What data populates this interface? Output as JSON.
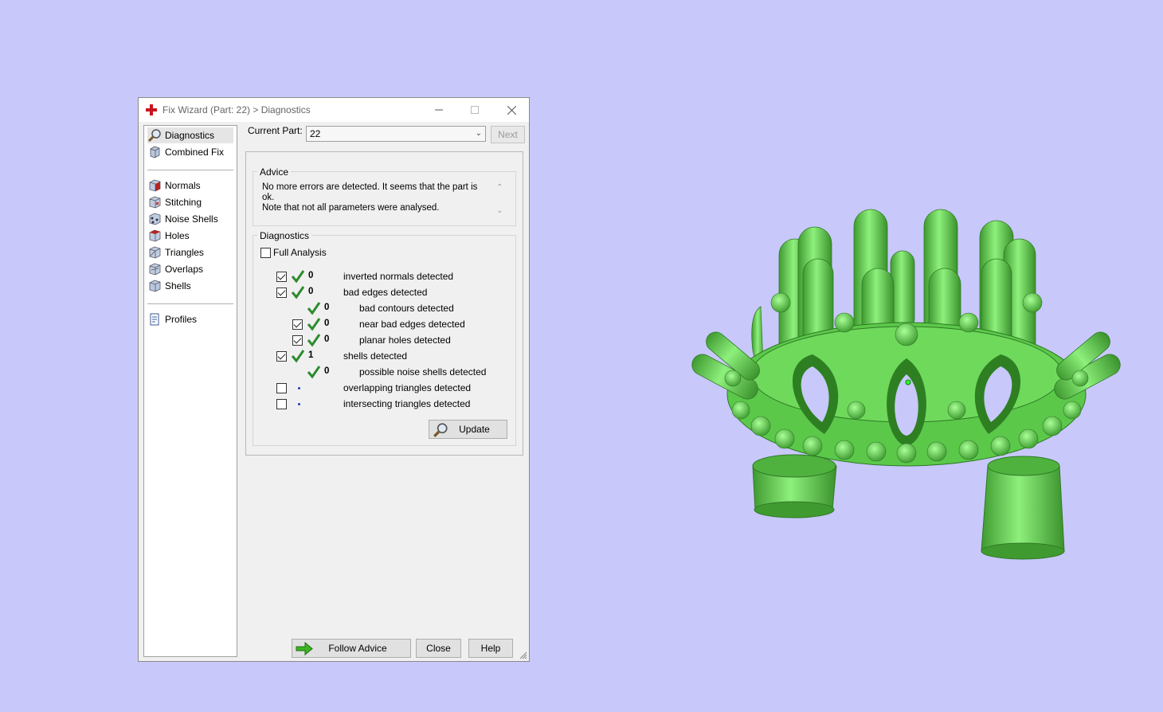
{
  "window": {
    "title": "Fix Wizard (Part: 22) > Diagnostics"
  },
  "sidebar": {
    "items": [
      {
        "label": "Diagnostics",
        "icon": "magnifier-icon",
        "selected": true
      },
      {
        "label": "Combined Fix",
        "icon": "cube-icon"
      },
      {
        "label": "Normals",
        "icon": "cube-red-face-icon"
      },
      {
        "label": "Stitching",
        "icon": "cube-stitch-icon"
      },
      {
        "label": "Noise Shells",
        "icon": "cube-dots-icon"
      },
      {
        "label": "Holes",
        "icon": "cube-red-hole-icon"
      },
      {
        "label": "Triangles",
        "icon": "cube-triangle-icon"
      },
      {
        "label": "Overlaps",
        "icon": "cube-overlap-icon"
      },
      {
        "label": "Shells",
        "icon": "cube-icon"
      },
      {
        "label": "Profiles",
        "icon": "document-icon"
      }
    ]
  },
  "toolbar": {
    "current_part_label": "Current Part:",
    "current_part_value": "22",
    "next_label": "Next"
  },
  "advice": {
    "group_label": "Advice",
    "line1": "No more errors are detected. It seems that the part is ok.",
    "line2": "Note that not all parameters were analysed."
  },
  "diagnostics": {
    "group_label": "Diagnostics",
    "full_analysis_label": "Full Analysis",
    "rows": [
      {
        "checkbox": true,
        "checked": true,
        "status": "ok",
        "value": "0",
        "label": "inverted normals detected",
        "indent": 0
      },
      {
        "checkbox": true,
        "checked": true,
        "status": "ok",
        "value": "0",
        "label": "bad edges detected",
        "indent": 0
      },
      {
        "checkbox": false,
        "checked": false,
        "status": "ok",
        "value": "0",
        "label": "bad contours detected",
        "indent": 1
      },
      {
        "checkbox": true,
        "checked": true,
        "status": "ok",
        "value": "0",
        "label": "near bad edges detected",
        "indent": 1
      },
      {
        "checkbox": true,
        "checked": true,
        "status": "ok",
        "value": "0",
        "label": "planar holes detected",
        "indent": 1
      },
      {
        "checkbox": true,
        "checked": true,
        "status": "ok",
        "value": "1",
        "label": "shells detected",
        "indent": 0
      },
      {
        "checkbox": false,
        "checked": false,
        "status": "ok",
        "value": "0",
        "label": "possible noise shells detected",
        "indent": 1
      },
      {
        "checkbox": true,
        "checked": false,
        "status": "pending",
        "value": "",
        "label": "overlapping triangles detected",
        "indent": 0
      },
      {
        "checkbox": true,
        "checked": false,
        "status": "pending",
        "value": "",
        "label": "intersecting triangles detected",
        "indent": 0
      }
    ],
    "update_label": "Update"
  },
  "footer": {
    "follow_advice_label": "Follow Advice",
    "close_label": "Close",
    "help_label": "Help"
  },
  "colors": {
    "background": "#c8c8fa",
    "model_green": "#5fcf4f",
    "check_green": "#2e8b2e"
  }
}
